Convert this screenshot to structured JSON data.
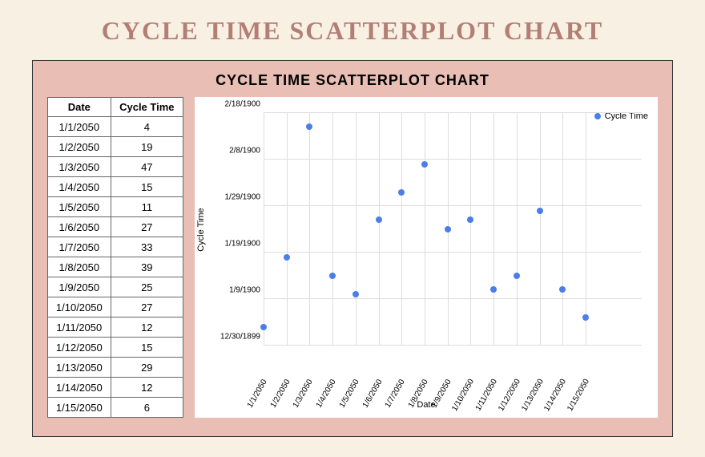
{
  "page_title": "CYCLE TIME SCATTERPLOT CHART",
  "chart_title": "CYCLE TIME SCATTERPLOT CHART",
  "table": {
    "headers": {
      "date": "Date",
      "cycle_time": "Cycle Time"
    },
    "rows": [
      {
        "date": "1/1/2050",
        "cycle_time": "4"
      },
      {
        "date": "1/2/2050",
        "cycle_time": "19"
      },
      {
        "date": "1/3/2050",
        "cycle_time": "47"
      },
      {
        "date": "1/4/2050",
        "cycle_time": "15"
      },
      {
        "date": "1/5/2050",
        "cycle_time": "11"
      },
      {
        "date": "1/6/2050",
        "cycle_time": "27"
      },
      {
        "date": "1/7/2050",
        "cycle_time": "33"
      },
      {
        "date": "1/8/2050",
        "cycle_time": "39"
      },
      {
        "date": "1/9/2050",
        "cycle_time": "25"
      },
      {
        "date": "1/10/2050",
        "cycle_time": "27"
      },
      {
        "date": "1/11/2050",
        "cycle_time": "12"
      },
      {
        "date": "1/12/2050",
        "cycle_time": "15"
      },
      {
        "date": "1/13/2050",
        "cycle_time": "29"
      },
      {
        "date": "1/14/2050",
        "cycle_time": "12"
      },
      {
        "date": "1/15/2050",
        "cycle_time": "6"
      }
    ]
  },
  "legend": {
    "label": "Cycle Time"
  },
  "axes": {
    "xlabel": "Date",
    "ylabel": "Cycle Time",
    "y_ticks": [
      "12/30/1899",
      "1/9/1900",
      "1/19/1900",
      "1/29/1900",
      "2/8/1900",
      "2/18/1900"
    ],
    "x_ticks": [
      "1/1/2050",
      "1/2/2050",
      "1/3/2050",
      "1/4/2050",
      "1/5/2050",
      "1/6/2050",
      "1/7/2050",
      "1/8/2050",
      "1/9/2050",
      "1/10/2050",
      "1/11/2050",
      "1/12/2050",
      "1/13/2050",
      "1/14/2050",
      "1/15/2050"
    ]
  },
  "chart_data": {
    "type": "scatter",
    "title": "CYCLE TIME SCATTERPLOT CHART",
    "xlabel": "Date",
    "ylabel": "Cycle Time",
    "x": [
      "1/1/2050",
      "1/2/2050",
      "1/3/2050",
      "1/4/2050",
      "1/5/2050",
      "1/6/2050",
      "1/7/2050",
      "1/8/2050",
      "1/9/2050",
      "1/10/2050",
      "1/11/2050",
      "1/12/2050",
      "1/13/2050",
      "1/14/2050",
      "1/15/2050"
    ],
    "series": [
      {
        "name": "Cycle Time",
        "values": [
          4,
          19,
          47,
          15,
          11,
          27,
          33,
          39,
          25,
          27,
          12,
          15,
          29,
          12,
          6
        ]
      }
    ],
    "ylim": [
      0,
      50
    ],
    "legend_position": "top-right"
  }
}
